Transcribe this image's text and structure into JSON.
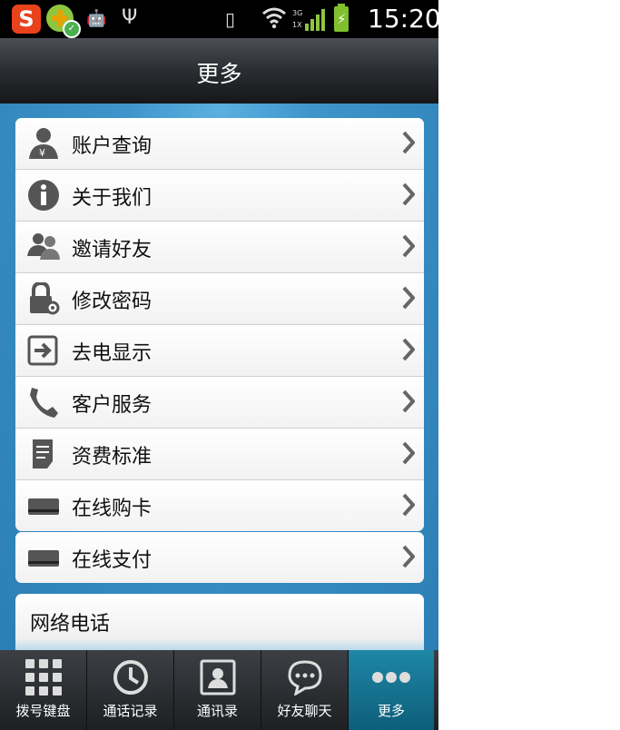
{
  "status_bar": {
    "time": "15:20",
    "network_top": "3G",
    "network_bottom": "1X"
  },
  "title": "更多",
  "menu": [
    {
      "label": "账户查询",
      "icon": "account-icon"
    },
    {
      "label": "关于我们",
      "icon": "info-icon"
    },
    {
      "label": "邀请好友",
      "icon": "invite-friends-icon"
    },
    {
      "label": "修改密码",
      "icon": "lock-settings-icon"
    },
    {
      "label": "去电显示",
      "icon": "caller-display-icon"
    },
    {
      "label": "客户服务",
      "icon": "phone-icon"
    },
    {
      "label": "资费标准",
      "icon": "document-icon"
    },
    {
      "label": "在线购卡",
      "icon": "card-icon"
    }
  ],
  "menu2": [
    {
      "label": "在线支付",
      "icon": "card-icon"
    }
  ],
  "section": {
    "label": "网络电话"
  },
  "nav": [
    {
      "label": "拨号键盘",
      "icon": "keypad-icon"
    },
    {
      "label": "通话记录",
      "icon": "clock-icon"
    },
    {
      "label": "通讯录",
      "icon": "contacts-icon"
    },
    {
      "label": "好友聊天",
      "icon": "chat-icon"
    },
    {
      "label": "更多",
      "icon": "more-icon",
      "active": true
    }
  ],
  "colors": {
    "accent": "#2f83b8",
    "active_tab": "#1f87a7"
  }
}
